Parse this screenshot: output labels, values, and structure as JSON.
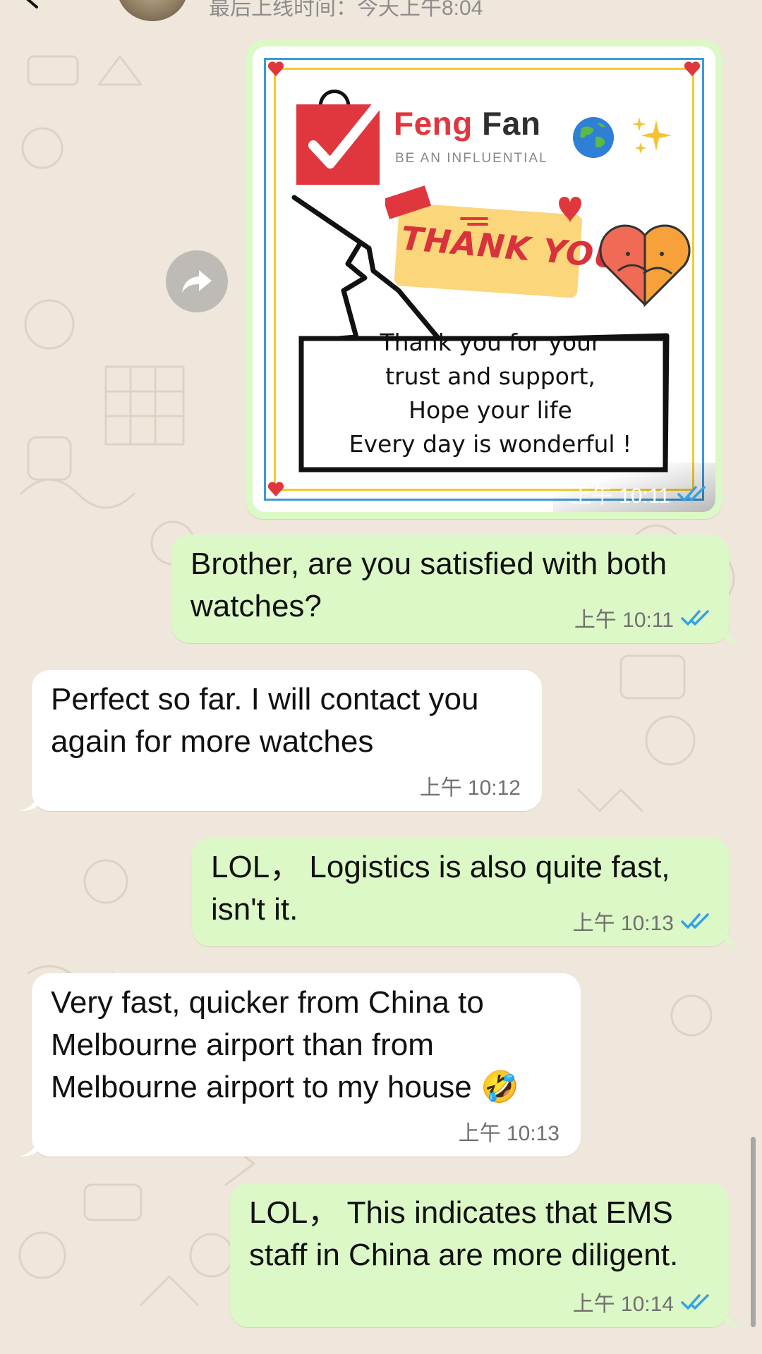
{
  "header": {
    "last_seen": "最后上线时间：今天上午8:04"
  },
  "colors": {
    "outgoing_bubble": "#dcf8c6",
    "incoming_bubble": "#ffffff",
    "read_ticks": "#34a1e8",
    "background": "#efe7dc"
  },
  "image_message": {
    "brand_name_part1": "Feng",
    "brand_name_part2": "Fan",
    "brand_tagline": "BE AN INFLUENTIAL",
    "sticker_text": "THANK YOU",
    "card_text": "Thank you for your\ntrust and support,\nHope your life\nEvery day is wonderful !",
    "time": "上午 10:11",
    "status": "read"
  },
  "messages": [
    {
      "direction": "outgoing",
      "text": "Brother, are you satisfied with both\nwatches?",
      "time": "上午 10:11",
      "status": "read"
    },
    {
      "direction": "incoming",
      "text": "Perfect so far. I will contact you\nagain for more watches",
      "time": "上午 10:12"
    },
    {
      "direction": "outgoing",
      "text": "LOL，  Logistics is also quite fast,\nisn't it.",
      "time": "上午 10:13",
      "status": "read"
    },
    {
      "direction": "incoming",
      "text": "Very fast, quicker from China to\nMelbourne airport than from\nMelbourne airport to my house 🤣",
      "time": "上午 10:13"
    },
    {
      "direction": "outgoing",
      "text": "LOL，  This indicates that EMS\nstaff in China are more diligent.",
      "time": "上午 10:14",
      "status": "read"
    }
  ],
  "icons": {
    "back": "chevron-left-icon",
    "video_call": "video-camera-icon",
    "voice_call": "phone-icon",
    "forward": "share-forward-icon",
    "read_receipt": "double-check-icon"
  }
}
